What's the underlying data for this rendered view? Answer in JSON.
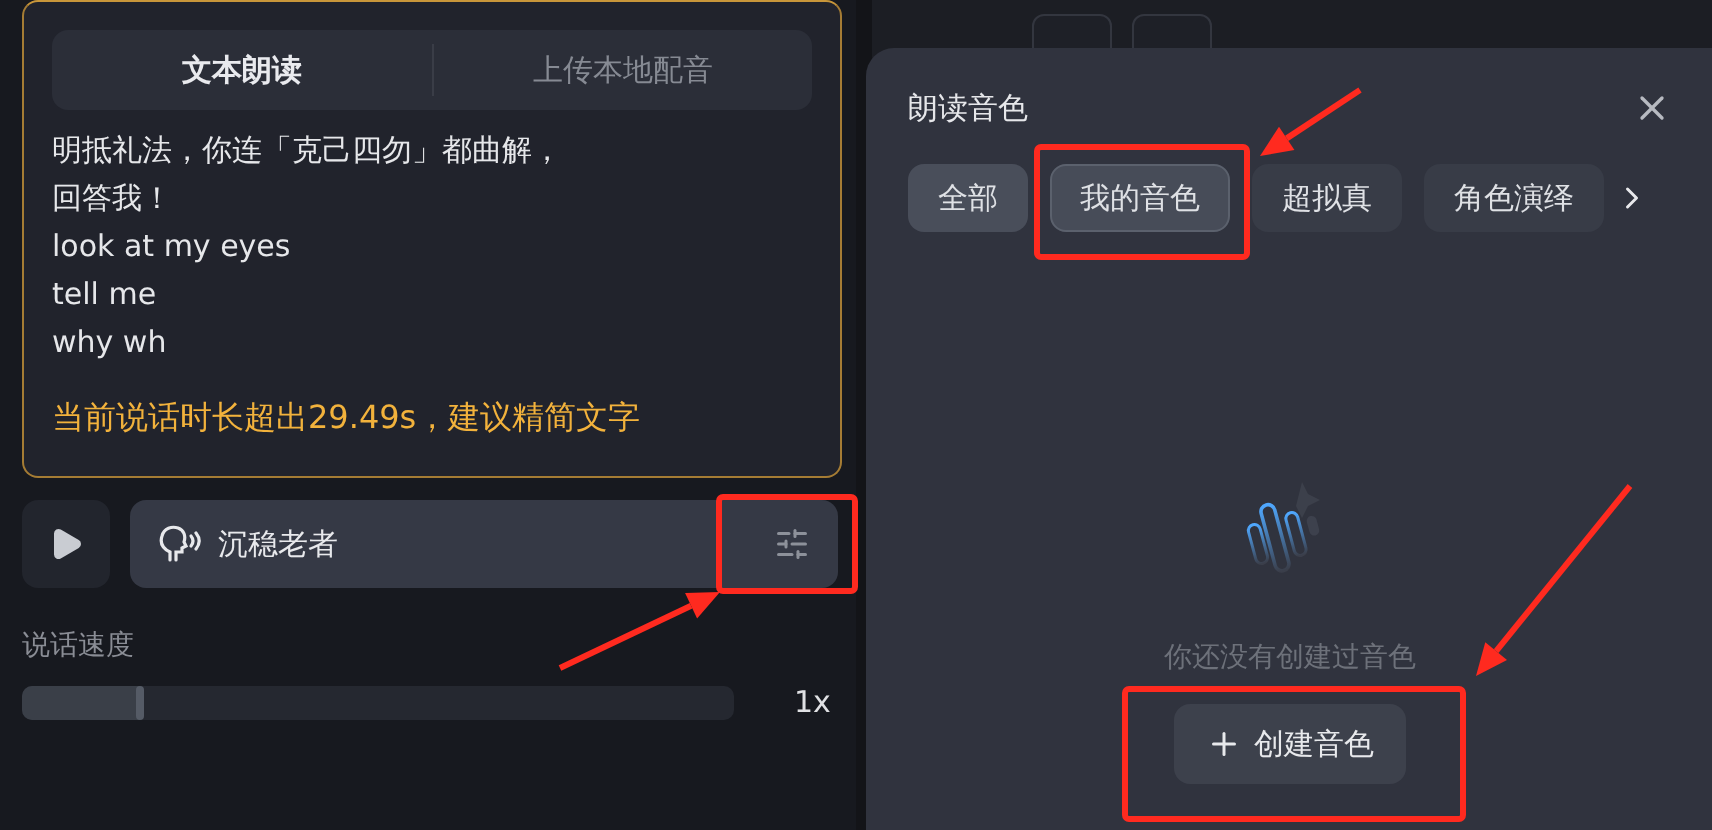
{
  "editor": {
    "tabs": [
      {
        "label": "文本朗读",
        "selected": true
      },
      {
        "label": "上传本地配音",
        "selected": false
      }
    ],
    "lines": [
      "明抵礼法，你连「克己四勿」都曲解，",
      "回答我！",
      "look at my eyes",
      "tell me",
      "why wh"
    ],
    "warning": "当前说话时长超出29.49s，建议精简文字"
  },
  "voice": {
    "name": "沉稳老者"
  },
  "speed": {
    "label": "说话速度",
    "level": 0.165,
    "reading": "1x"
  },
  "voice_panel": {
    "title": "朗读音色",
    "categories": [
      {
        "label": "全部",
        "selected": false
      },
      {
        "label": "我的音色",
        "selected": true
      },
      {
        "label": "超拟真",
        "selected": false
      },
      {
        "label": "角色演绎",
        "selected": false
      }
    ],
    "empty_text": "你还没有创建过音色",
    "create_button": "创建音色"
  }
}
